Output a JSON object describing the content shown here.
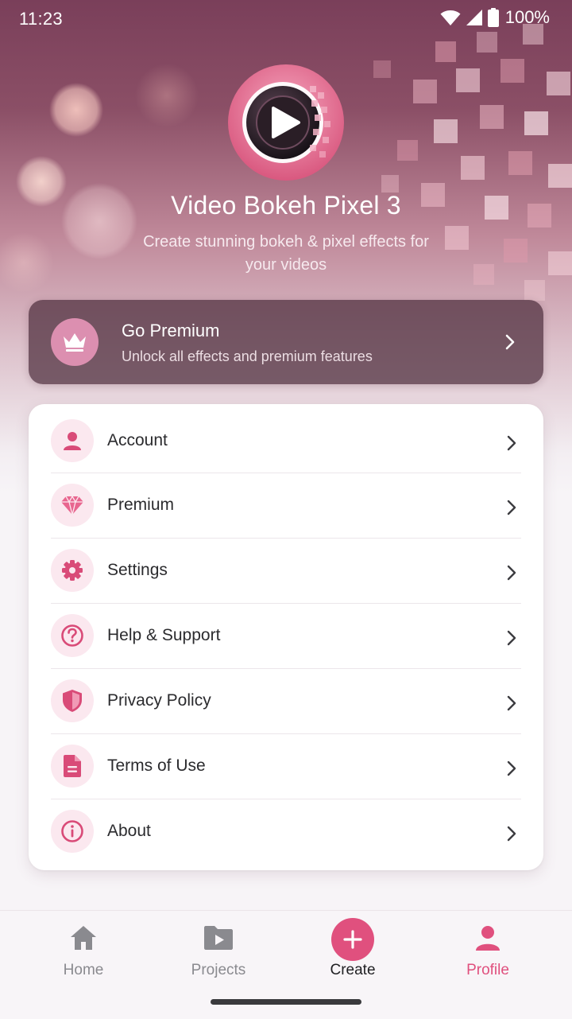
{
  "status_bar": {
    "time": "11:23",
    "battery": "100%",
    "icons": [
      "wifi-icon",
      "cellular-signal-icon",
      "battery-icon"
    ]
  },
  "app": {
    "title": "Video Bokeh Pixel 3",
    "subtitle": "Create stunning bokeh & pixel effects for your videos",
    "logo_icon": "play-icon"
  },
  "premium_banner": {
    "title": "Go Premium",
    "description": "Unlock all effects and premium features",
    "icon": "crown-icon"
  },
  "menu": {
    "items": [
      {
        "label": "Account",
        "icon": "person-icon"
      },
      {
        "label": "Premium",
        "icon": "diamond-icon"
      },
      {
        "label": "Settings",
        "icon": "gear-icon"
      },
      {
        "label": "Help & Support",
        "icon": "help-icon"
      },
      {
        "label": "Privacy Policy",
        "icon": "shield-icon"
      },
      {
        "label": "Terms of Use",
        "icon": "document-icon"
      },
      {
        "label": "About",
        "icon": "info-icon"
      }
    ]
  },
  "bottom_nav": {
    "items": [
      {
        "label": "Home",
        "icon": "home-icon",
        "active": false
      },
      {
        "label": "Projects",
        "icon": "video-folder-icon",
        "active": false
      },
      {
        "label": "Create",
        "icon": "plus-icon",
        "active": false
      },
      {
        "label": "Profile",
        "icon": "person-icon",
        "active": true
      }
    ]
  },
  "colors": {
    "accent": "#e0507e",
    "menu_icon_bg": "#fbe8ef",
    "premium_badge": "#dc8fb0",
    "nav_inactive": "#8a8a8f"
  }
}
